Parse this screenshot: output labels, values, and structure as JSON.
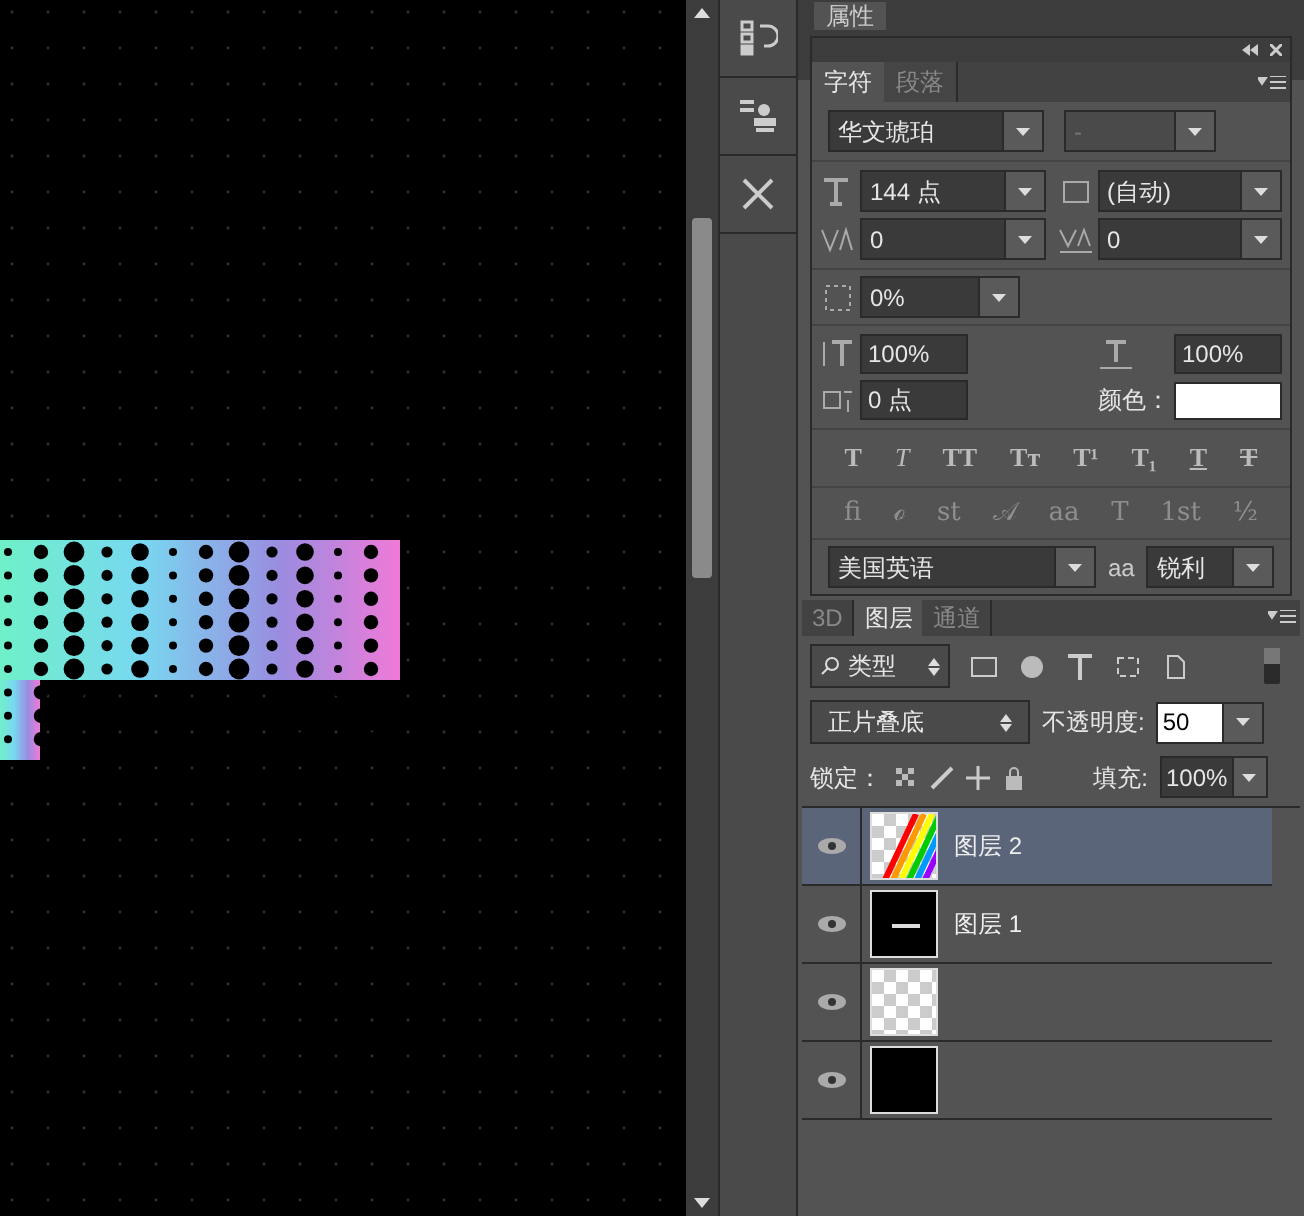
{
  "properties_panel": {
    "tab": "属性"
  },
  "character_panel": {
    "tabs": [
      {
        "label": "字符",
        "selected": true
      },
      {
        "label": "段落",
        "selected": false
      }
    ],
    "font_family": "华文琥珀",
    "font_style": "-",
    "font_style_disabled": true,
    "size": "144 点",
    "leading": "(自动)",
    "kerning": "0",
    "tracking": "0",
    "tsume": "0%",
    "vertical_scale": "100%",
    "horizontal_scale": "100%",
    "baseline_shift": "0 点",
    "color_label": "颜色：",
    "color": "#ffffff",
    "style_buttons": [
      {
        "glyph": "T",
        "kind": "bold"
      },
      {
        "glyph": "T",
        "kind": "italic"
      },
      {
        "glyph": "TT",
        "kind": "caps"
      },
      {
        "glyph": "Tт",
        "kind": "smallcaps"
      },
      {
        "glyph": "T¹",
        "kind": "super"
      },
      {
        "glyph": "T₁",
        "kind": "sub"
      },
      {
        "glyph": "T",
        "kind": "underline"
      },
      {
        "glyph": "T",
        "kind": "strike"
      }
    ],
    "opentype_buttons": [
      {
        "glyph": "fi",
        "disabled": true
      },
      {
        "glyph": "ℴ",
        "disabled": true
      },
      {
        "glyph": "st",
        "disabled": true
      },
      {
        "glyph": "𝒜",
        "disabled": true
      },
      {
        "glyph": "aa",
        "disabled": true
      },
      {
        "glyph": "T",
        "disabled": true
      },
      {
        "glyph": "1st",
        "disabled": true
      },
      {
        "glyph": "½",
        "disabled": true
      }
    ],
    "language": "美国英语",
    "aa_label": "aa",
    "antialias": "锐利"
  },
  "layers_panel": {
    "tabs": [
      {
        "label": "3D",
        "selected": false
      },
      {
        "label": "图层",
        "selected": true
      },
      {
        "label": "通道",
        "selected": false
      }
    ],
    "filter": "类型",
    "filter_on": true,
    "blend_mode": "正片叠底",
    "opacity_label": "不透明度:",
    "opacity": "50",
    "lock_label": "锁定：",
    "fill_label": "填充:",
    "fill": "100%",
    "layers": [
      {
        "name": "图层 2",
        "kind": "rainbow",
        "visible": true,
        "selected": true
      },
      {
        "name": "图层 1",
        "kind": "text",
        "visible": true,
        "selected": false
      },
      {
        "kind": "transparent",
        "visible": true,
        "selected": false
      },
      {
        "kind": "black",
        "visible": true,
        "selected": false
      }
    ]
  }
}
